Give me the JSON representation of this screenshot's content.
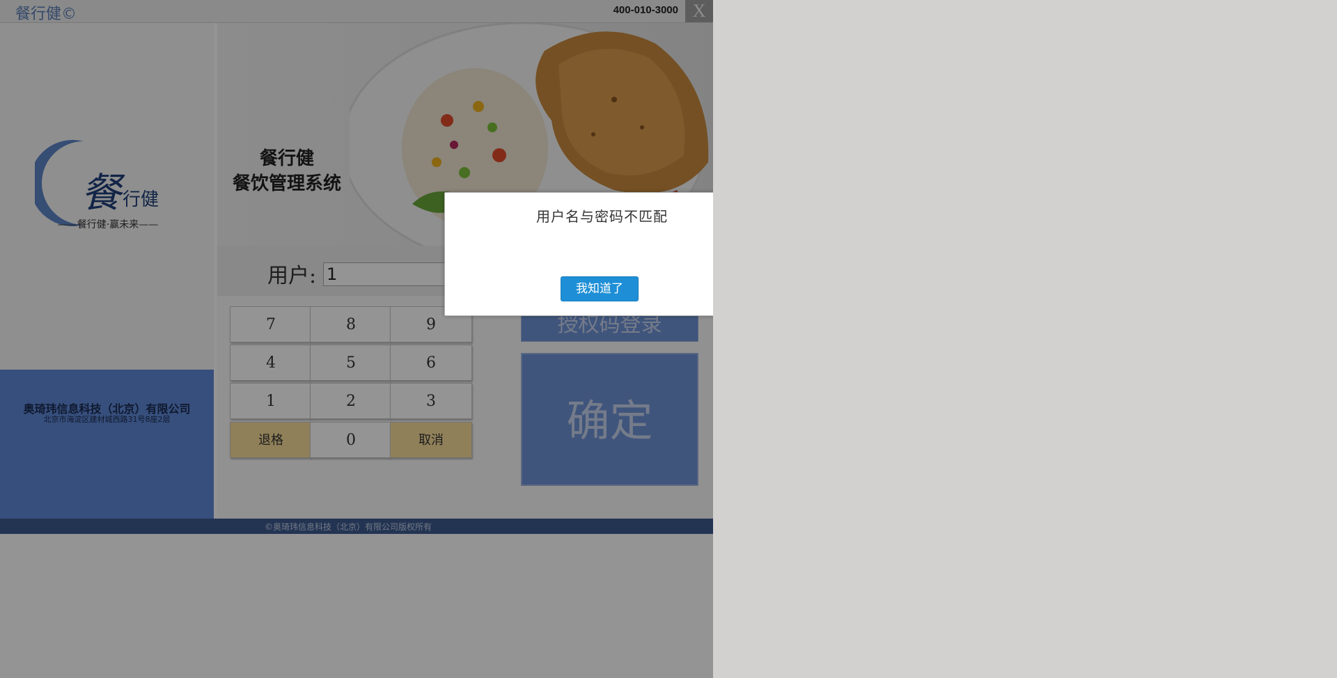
{
  "header": {
    "app_title": "餐行健©",
    "hotline": "400-010-3000",
    "close_label": "X"
  },
  "logo": {
    "brand_glyph_big": "餐",
    "brand_glyph_small": "行健",
    "slogan": "——餐行健·赢未来——"
  },
  "company": {
    "name": "奥琦玮信息科技（北京）有限公司",
    "address": "北京市海淀区建材城西路31号8座2层"
  },
  "banner": {
    "line1": "餐行健",
    "line2": "餐饮管理系统"
  },
  "login": {
    "user_label": "用户:",
    "user_value": "1"
  },
  "keypad": {
    "keys": [
      {
        "label": "7",
        "style": "normal"
      },
      {
        "label": "8",
        "style": "normal"
      },
      {
        "label": "9",
        "style": "normal"
      },
      {
        "label": "4",
        "style": "normal"
      },
      {
        "label": "5",
        "style": "normal"
      },
      {
        "label": "6",
        "style": "normal"
      },
      {
        "label": "1",
        "style": "normal"
      },
      {
        "label": "2",
        "style": "normal"
      },
      {
        "label": "3",
        "style": "normal"
      },
      {
        "label": "退格",
        "style": "warm"
      },
      {
        "label": "0",
        "style": "normal"
      },
      {
        "label": "取消",
        "style": "warm"
      }
    ],
    "auth_login_label": "授权码登录",
    "confirm_label": "确定"
  },
  "footer": {
    "copyright": "©奥琦玮信息科技（北京）有限公司版权所有"
  },
  "dialog": {
    "message": "用户名与密码不匹配",
    "ok_label": "我知道了"
  },
  "colors": {
    "accent_blue": "#6e93d6",
    "warm_key": "#f8dc9a",
    "dialog_button": "#1e8fd6",
    "footer": "#3d5a8f"
  }
}
